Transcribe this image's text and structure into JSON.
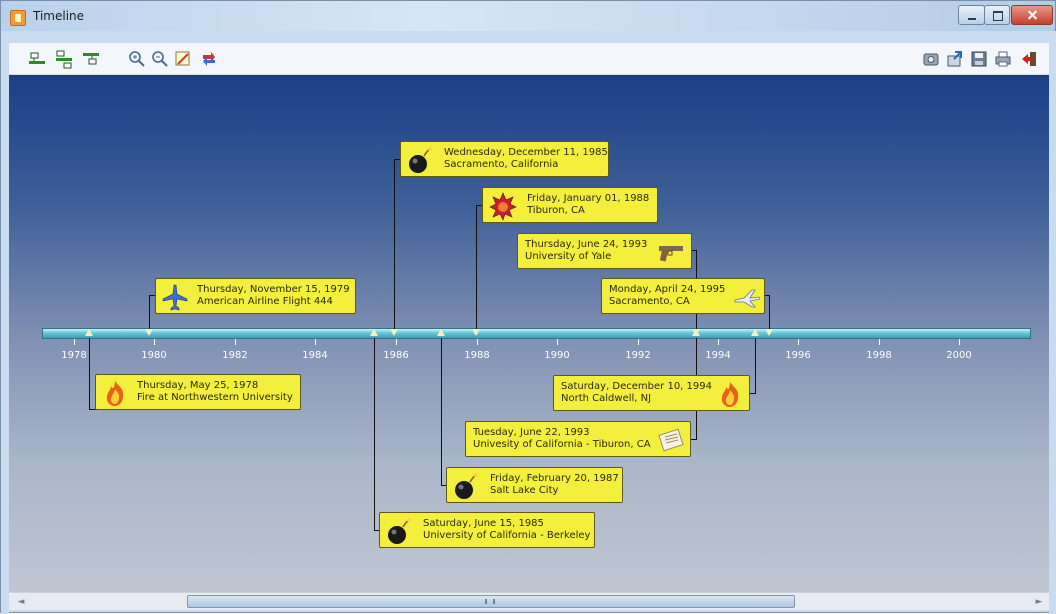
{
  "window": {
    "title": "Timeline",
    "accent": "#f19a3a"
  },
  "toolbar": {
    "left_icons": [
      "layout-above-icon",
      "layout-alternate-icon",
      "layout-below-icon",
      "zoom-in-icon",
      "zoom-out-icon",
      "edit-icon",
      "refresh-icon"
    ],
    "right_icons": [
      "snapshot-icon",
      "export-icon",
      "save-icon",
      "print-icon",
      "exit-icon"
    ]
  },
  "axis": {
    "years": [
      "1978",
      "1980",
      "1982",
      "1984",
      "1986",
      "1988",
      "1990",
      "1992",
      "1994",
      "1996",
      "1998",
      "2000"
    ],
    "bar_color": "#5fc2d2"
  },
  "events": [
    {
      "id": "fire-1978",
      "date": "Thursday, May 25, 1978",
      "place": "Fire at Northwestern University",
      "icon": "fire-icon"
    },
    {
      "id": "flight-1979",
      "date": "Thursday, November 15, 1979",
      "place": "American Airline Flight 444",
      "icon": "airplane-icon"
    },
    {
      "id": "bomb-1985-berkeley",
      "date": "Saturday, June 15, 1985",
      "place": "University of California - Berkeley",
      "icon": "bomb-icon"
    },
    {
      "id": "bomb-1985-sacramento",
      "date": "Wednesday, December 11, 1985",
      "place": "Sacramento, California",
      "icon": "bomb-icon"
    },
    {
      "id": "bomb-1987",
      "date": "Friday, February 20, 1987",
      "place": "Salt Lake City",
      "icon": "bomb-icon"
    },
    {
      "id": "explosion-1988",
      "date": "Friday, January 01, 1988",
      "place": "Tiburon, CA",
      "icon": "explosion-icon"
    },
    {
      "id": "letter-1993",
      "date": "Tuesday, June 22, 1993",
      "place": "Univesity of California - Tiburon, CA",
      "icon": "letter-icon"
    },
    {
      "id": "gun-1993",
      "date": "Thursday, June 24, 1993",
      "place": "University of Yale",
      "icon": "gun-icon"
    },
    {
      "id": "fire-1994",
      "date": "Saturday, December 10, 1994",
      "place": "North Caldwell, NJ",
      "icon": "fire-icon"
    },
    {
      "id": "plane-1995",
      "date": "Monday, April 24, 1995",
      "place": "Sacramento, CA",
      "icon": "jet-icon"
    }
  ],
  "colors": {
    "event_fill": "#f3ef3c",
    "canvas_top": "#1b3e86",
    "canvas_bottom": "#bfc6d1"
  }
}
